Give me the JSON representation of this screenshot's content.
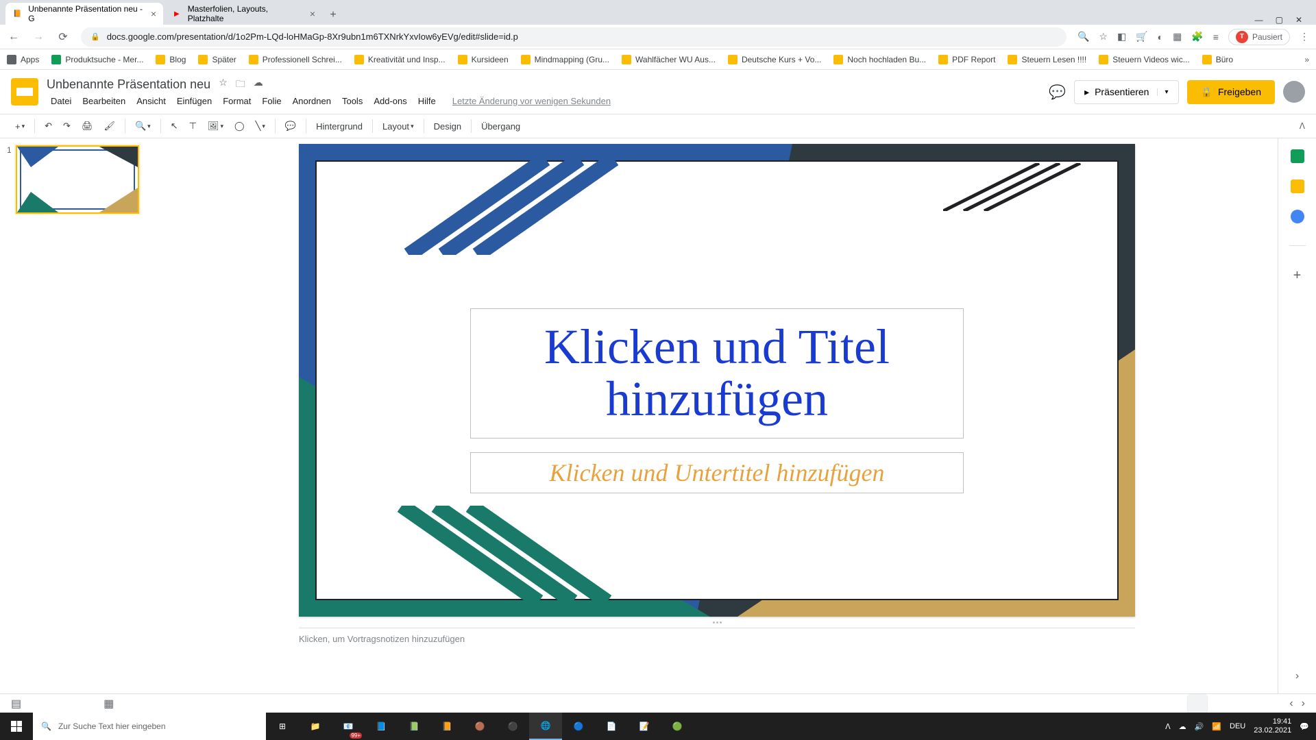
{
  "browser": {
    "tabs": [
      {
        "title": "Unbenannte Präsentation neu - G",
        "favicon": "slides"
      },
      {
        "title": "Masterfolien, Layouts, Platzhalte",
        "favicon": "youtube"
      }
    ],
    "url": "docs.google.com/presentation/d/1o2Pm-LQd-loHMaGp-8Xr9ubn1m6TXNrkYxvIow6yEVg/edit#slide=id.p",
    "pausedLabel": "Pausiert",
    "bookmarks": [
      "Apps",
      "Produktsuche - Mer...",
      "Blog",
      "Später",
      "Professionell Schrei...",
      "Kreativität und Insp...",
      "Kursideen",
      "Mindmapping (Gru...",
      "Wahlfächer WU Aus...",
      "Deutsche Kurs + Vo...",
      "Noch hochladen Bu...",
      "PDF Report",
      "Steuern Lesen !!!!",
      "Steuern Videos wic...",
      "Büro"
    ]
  },
  "app": {
    "docTitle": "Unbenannte Präsentation neu",
    "menu": [
      "Datei",
      "Bearbeiten",
      "Ansicht",
      "Einfügen",
      "Format",
      "Folie",
      "Anordnen",
      "Tools",
      "Add-ons",
      "Hilfe"
    ],
    "lastChange": "Letzte Änderung vor wenigen Sekunden",
    "presentLabel": "Präsentieren",
    "shareLabel": "Freigeben"
  },
  "toolbar": {
    "hintergrund": "Hintergrund",
    "layout": "Layout",
    "design": "Design",
    "uebergang": "Übergang"
  },
  "slide": {
    "number": "1",
    "titlePlaceholder": "Klicken und Titel hinzufügen",
    "subtitlePlaceholder": "Klicken und Untertitel hinzufügen"
  },
  "notes": {
    "placeholder": "Klicken, um Vortragsnotizen hinzuzufügen"
  },
  "taskbar": {
    "searchPlaceholder": "Zur Suche Text hier eingeben",
    "lang": "DEU",
    "time": "19:41",
    "date": "23.02.2021",
    "badge": "99+"
  },
  "colors": {
    "blue": "#2c5aa0",
    "teal": "#1a7a6a",
    "tan": "#c9a55c",
    "dark": "#2e3a3f",
    "titleBlue": "#1a3bd1",
    "subtitleOrange": "#e8a23d"
  }
}
